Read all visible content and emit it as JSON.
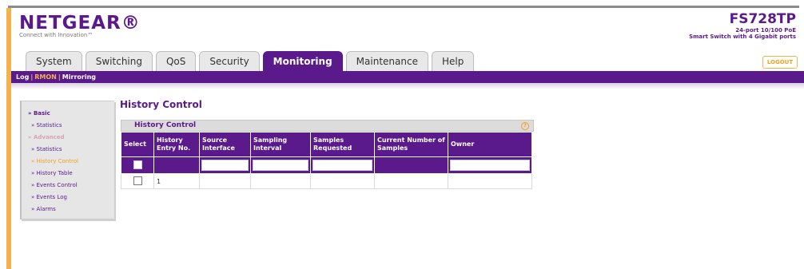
{
  "header": {
    "brand": "NETGEAR®",
    "tagline": "Connect with Innovation™",
    "model": "FS728TP",
    "model_desc_1": "24-port 10/100 PoE",
    "model_desc_2": "Smart Switch with 4 Gigabit ports",
    "logout": "LOGOUT"
  },
  "tabs": [
    "System",
    "Switching",
    "QoS",
    "Security",
    "Monitoring",
    "Maintenance",
    "Help"
  ],
  "active_tab": "Monitoring",
  "subnav": {
    "log": "Log",
    "rmon": "RMON",
    "mirroring": "Mirroring",
    "sep": "|"
  },
  "sidebar": {
    "basic": "» Basic",
    "statistics": "» Statistics",
    "advanced": "» Advanced",
    "adv_statistics": "» Statistics",
    "history_control": "» History Control",
    "history_table": "» History Table",
    "events_control": "» Events Control",
    "events_log": "» Events Log",
    "alarms": "» Alarms"
  },
  "page": {
    "title": "History Control",
    "panel_title": "History Control",
    "help_icon": "?",
    "columns": [
      "Select",
      "History Entry No.",
      "Source Interface",
      "Sampling Interval",
      "Samples Requested",
      "Current Number of Samples",
      "Owner"
    ],
    "rows": [
      {
        "entry": "1"
      }
    ]
  },
  "colors": {
    "brand": "#5a1a8c",
    "accent": "#f2b24d"
  }
}
